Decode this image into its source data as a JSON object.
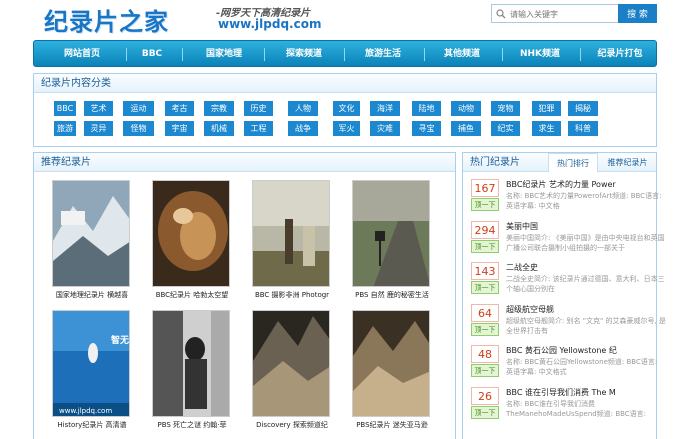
{
  "header": {
    "logo_text": "纪录片之家",
    "slogan": "-网罗天下高清纪录片",
    "url": "www.jlpdq.com"
  },
  "search": {
    "placeholder": "请输入关键字",
    "button_label": "搜 索"
  },
  "nav": {
    "items": [
      "网站首页",
      "BBC",
      "国家地理",
      "探索频道",
      "旅游生活",
      "其他频道",
      "NHK频道",
      "纪录片打包"
    ]
  },
  "categories": {
    "title": "纪录片内容分类",
    "row1": [
      "BBC",
      "艺术",
      "运动",
      "考古",
      "宗教",
      "历史",
      "人物",
      "文化",
      "海洋",
      "陆地",
      "动物",
      "宠物",
      "犯罪",
      "揭秘"
    ],
    "row2": [
      "旅游",
      "灵异",
      "怪物",
      "宇宙",
      "机械",
      "工程",
      "战争",
      "军火",
      "灾难",
      "寻宝",
      "捕鱼",
      "纪实",
      "求生",
      "科普"
    ]
  },
  "recommend": {
    "title": "推荐纪录片",
    "row1": [
      {
        "caption": "国家地理纪录片 横越喜"
      },
      {
        "caption": "BBC纪录片 哈勃太空望"
      },
      {
        "caption": "BBC 摄影非洲 Photogr"
      },
      {
        "caption": "PBS 自然 鹿的秘密生活"
      }
    ],
    "row2": [
      {
        "caption": "History纪录片 高清谱"
      },
      {
        "caption": "PBS 死亡之谜 约翰·菲"
      },
      {
        "caption": "Discovery 探索频道纪"
      },
      {
        "caption": "PBS纪录片 迷失亚马逊"
      }
    ],
    "thumb_watermark": "智无图片",
    "thumb_url": "www.jlpdq.com"
  },
  "hot": {
    "title": "热门纪录片",
    "tabs": [
      "热门排行",
      "推荐纪录片"
    ],
    "vote_label": "顶一下",
    "items": [
      {
        "score": "167",
        "title": "BBC纪录片 艺术的力量 Power",
        "desc": "名称: BBC艺术的力量PowerofArt频道: BBC语言: 英语字幕: 中文格"
      },
      {
        "score": "294",
        "title": "美丽中国",
        "desc": "美丽中国简介: 《美丽中国》是由中央电视台和英国广播公司联合摄制小组拍摄的一部关于"
      },
      {
        "score": "143",
        "title": "二战全史",
        "desc": "二战全史简介: 该纪录片通过德国、意大利、日本三个轴心国分别在"
      },
      {
        "score": "64",
        "title": "超级航空母舰",
        "desc": "超级航空母舰简介: 别名 \"文克\" 的艾森豪威尔号, 是全世界打击有"
      },
      {
        "score": "48",
        "title": "BBC 黄石公园 Yellowstone 纪",
        "desc": "名称: BBC黄石公园Yellowstone频道: BBC语言: 英语字幕: 中文格式"
      },
      {
        "score": "26",
        "title": "BBC 谁在引导我们消费 The M",
        "desc": "名称: BBC谁在引导我们消费TheManehoMadeUsSpend频道: BBC语言:"
      }
    ]
  },
  "colors": {
    "brand_blue": "#1a75c4",
    "nav_blue": "#0b82b8",
    "tag_blue": "#1c88d0",
    "score_red": "#d23c16",
    "vote_green": "#3e8a12"
  }
}
